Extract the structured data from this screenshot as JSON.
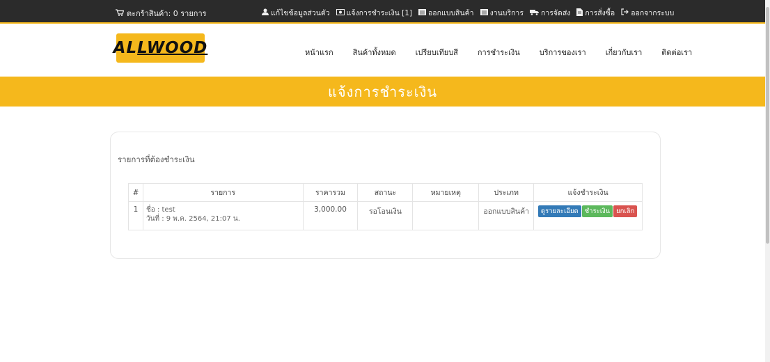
{
  "topbar": {
    "cart": {
      "icon": "cart-icon",
      "label": "ตะกร้าสินค้า: 0 รายการ"
    },
    "links": [
      {
        "icon": "user-icon",
        "label": "แก้ไขข้อมูลส่วนตัว"
      },
      {
        "icon": "money-icon",
        "label": "แจ้งการชำระเงิน [1]"
      },
      {
        "icon": "list-icon",
        "label": "ออกแบบสินค้า"
      },
      {
        "icon": "list-icon",
        "label": "งานบริการ"
      },
      {
        "icon": "truck-icon",
        "label": "การจัดส่ง"
      },
      {
        "icon": "file-icon",
        "label": "การสั่งซื้อ"
      },
      {
        "icon": "logout-icon",
        "label": "ออกจากระบบ"
      }
    ]
  },
  "logo": {
    "text_a": "AL",
    "text_b": "LWOOD"
  },
  "nav": [
    "หน้าแรก",
    "สินค้าทั้งหมด",
    "เปรียบเทียบสี",
    "การชำระเงิน",
    "บริการของเรา",
    "เกี่ยวกับเรา",
    "ติดต่อเรา"
  ],
  "banner": {
    "title": "แจ้งการชำระเงิน"
  },
  "panel": {
    "title": "รายการที่ต้องชำระเงิน",
    "columns": [
      "#",
      "รายการ",
      "ราคารวม",
      "สถานะ",
      "หมายเหตุ",
      "ประเภท",
      "แจ้งชำระเงิน"
    ],
    "rows": [
      {
        "num": "1",
        "name": "ชื่อ : test",
        "date": "วันที่ : 9 พ.ค. 2564, 21:07 น.",
        "price": "3,000.00",
        "status": "รอโอนเงิน",
        "note": "",
        "type": "ออกแบบสินค้า",
        "actions": {
          "detail": "ดูรายละเอียด",
          "pay": "ชำระเงิน",
          "cancel": "ยกเลิก"
        }
      }
    ]
  },
  "colors": {
    "accent": "#f5b81c",
    "topbar": "#2b2b2b",
    "blue": "#337ab7",
    "green": "#5cb85c",
    "red": "#d9534f"
  }
}
